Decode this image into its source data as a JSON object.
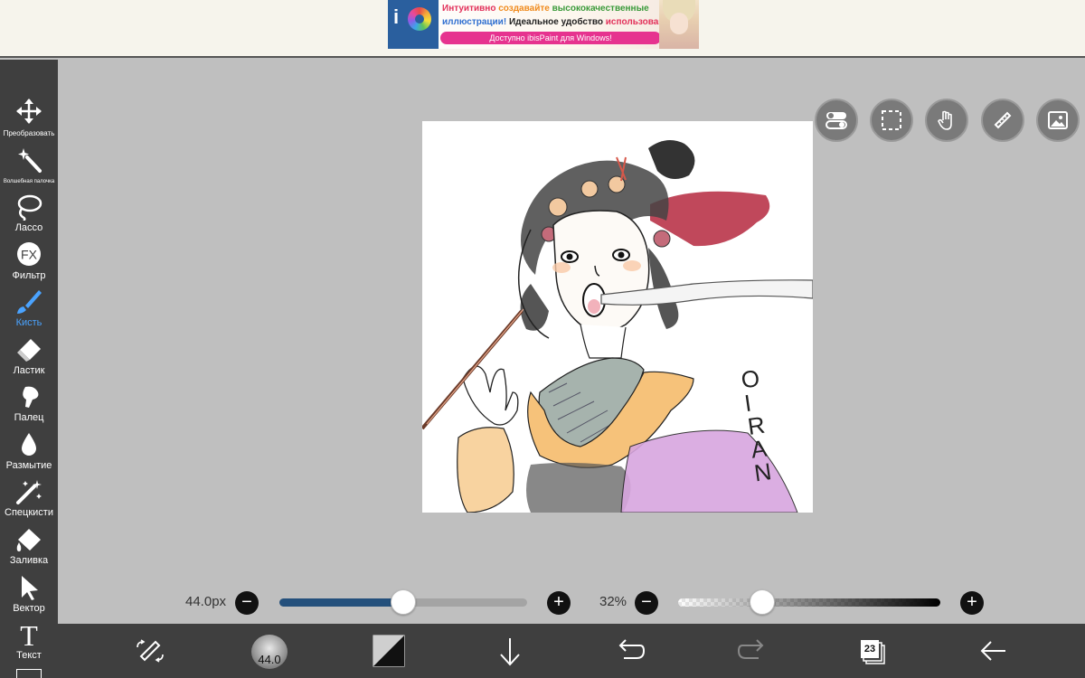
{
  "ad": {
    "line1_a": "Интуитивно ",
    "line1_b": "создавайте ",
    "line1_c": "высококачественные",
    "line2_a": "иллюстрации! ",
    "line2_b": "Идеальное удобство ",
    "line2_c": "использования!",
    "button": "Доступно ibisPaint для Windows!",
    "logo_text": "i"
  },
  "toolbar": {
    "items": [
      {
        "label": "Преобразовать",
        "icon": "move-arrows-icon"
      },
      {
        "label": "Волшебная палочка",
        "icon": "magic-wand-icon"
      },
      {
        "label": "Лассо",
        "icon": "lasso-icon"
      },
      {
        "label": "Фильтр",
        "icon": "fx-icon",
        "icon_text": "FX"
      },
      {
        "label": "Кисть",
        "icon": "brush-icon",
        "active": true
      },
      {
        "label": "Ластик",
        "icon": "eraser-icon"
      },
      {
        "label": "Палец",
        "icon": "smudge-icon"
      },
      {
        "label": "Размытие",
        "icon": "blur-drop-icon"
      },
      {
        "label": "Спецкисти",
        "icon": "special-brush-icon"
      },
      {
        "label": "Заливка",
        "icon": "fill-bucket-icon"
      },
      {
        "label": "Вектор",
        "icon": "vector-cursor-icon"
      },
      {
        "label": "Текст",
        "icon": "text-icon",
        "icon_text": "T"
      }
    ]
  },
  "artwork": {
    "signature": "OIRAN"
  },
  "floating_buttons": [
    "toggle-icon",
    "selection-icon",
    "hand-icon",
    "ruler-icon",
    "image-icon"
  ],
  "brush_size": {
    "label": "44.0px",
    "value_fraction": 0.5,
    "minus": "−",
    "plus": "+"
  },
  "opacity": {
    "label": "32%",
    "value_fraction": 0.32,
    "minus": "−",
    "plus": "+"
  },
  "bottom_bar": {
    "brush_size_text": "44.0",
    "layer_count": "23"
  },
  "colors": {
    "accent": "#4aa3ff",
    "slider_fill": "#24507c",
    "toolbar_bg": "#3f3f3f",
    "canvas_bg": "#bfbfbf"
  }
}
